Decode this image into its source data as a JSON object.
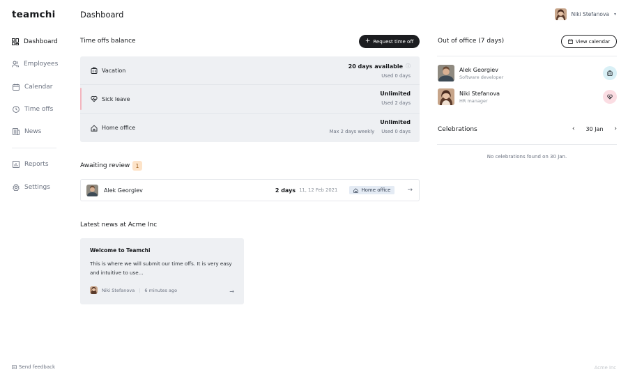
{
  "app": {
    "logo": "teamchi",
    "company": "Acme Inc"
  },
  "sidebar": {
    "items": [
      {
        "label": "Dashboard",
        "icon": "dashboard-icon",
        "active": true
      },
      {
        "label": "Employees",
        "icon": "users-icon"
      },
      {
        "label": "Calendar",
        "icon": "calendar-icon"
      },
      {
        "label": "Time offs",
        "icon": "clock-icon"
      },
      {
        "label": "News",
        "icon": "news-icon"
      }
    ],
    "secondary": [
      {
        "label": "Reports",
        "icon": "chart-icon"
      },
      {
        "label": "Settings",
        "icon": "gear-icon"
      }
    ],
    "feedback": "Send feedback"
  },
  "header": {
    "title": "Dashboard",
    "user_name": "Niki Stefanova"
  },
  "balance": {
    "title": "Time offs balance",
    "request_button": "Request time off",
    "rows": [
      {
        "name": "Vacation",
        "icon": "briefcase-icon",
        "main": "20 days available",
        "extra": "",
        "sub": "Used 0 days"
      },
      {
        "name": "Sick leave",
        "icon": "heart-pulse-icon",
        "main": "Unlimited",
        "extra": "",
        "sub": "Used 2 days"
      },
      {
        "name": "Home office",
        "icon": "home-icon",
        "main": "Unlimited",
        "extra": "Max 2 days weekly",
        "sub": "Used 0 days"
      }
    ]
  },
  "review": {
    "title": "Awaiting review",
    "count": "1",
    "item": {
      "name": "Alek Georgiev",
      "days": "2 days",
      "date": "11, 12 Feb 2021",
      "type": "Home office"
    }
  },
  "news": {
    "title": "Latest news at Acme Inc",
    "card": {
      "title": "Welcome to Teamchi",
      "body": "This is where we will submit our time offs. It is very easy and intuitive to use...",
      "author": "Niki Stefanova",
      "time": "6 minutes ago"
    }
  },
  "ooo": {
    "title": "Out of office (7 days)",
    "view_button": "View calendar",
    "people": [
      {
        "name": "Alek Georgiev",
        "role": "Software developer",
        "status_icon": "briefcase-icon",
        "color": "#d9f0f6"
      },
      {
        "name": "Niki Stefanova",
        "role": "HR manager",
        "status_icon": "heart-pulse-icon",
        "color": "#fbdde3"
      }
    ]
  },
  "celebrations": {
    "title": "Celebrations",
    "date": "30 Jan",
    "empty": "No celebrations found on 30 Jan."
  }
}
